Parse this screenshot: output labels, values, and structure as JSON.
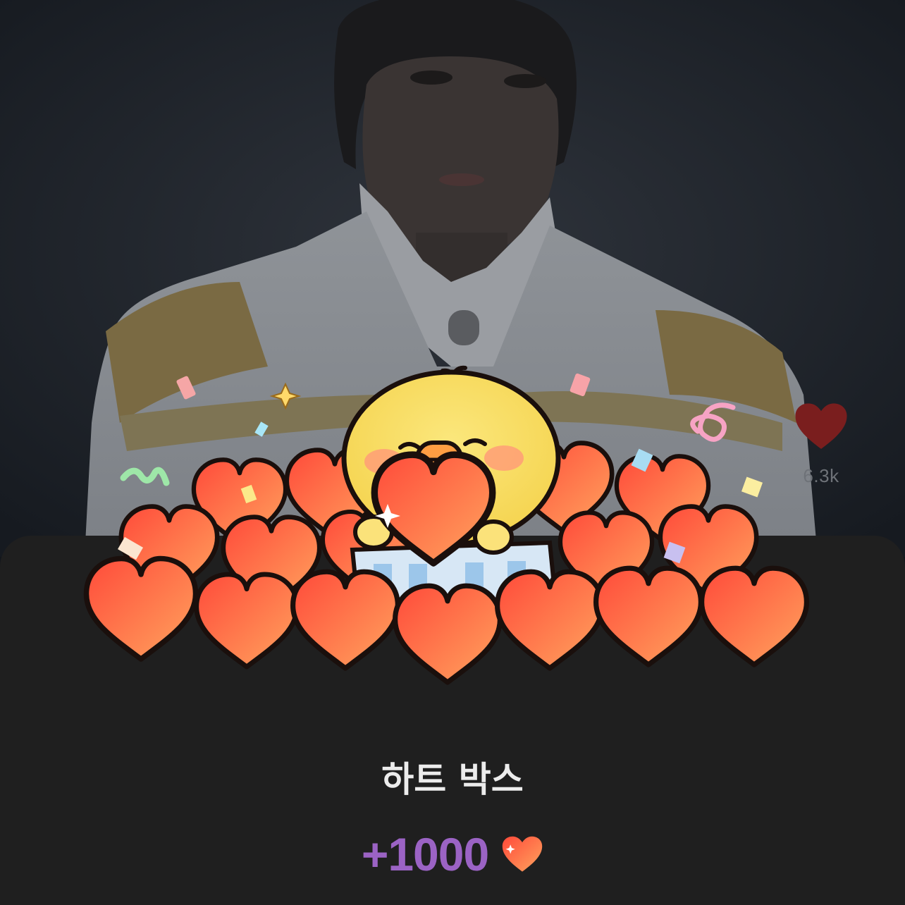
{
  "background_photo": {
    "icon": "person-photo-dimmed"
  },
  "like": {
    "icon": "heart-icon",
    "count": "6.3k",
    "color": "#7a1e1e"
  },
  "gift": {
    "illustration": "chick-holding-heart-in-heart-box",
    "title": "하트 박스",
    "value": "+1000",
    "value_color": "#9b63c4",
    "heart_icon": "heart-icon"
  },
  "colors": {
    "sheet": "#1f1f1f",
    "heart_light": "#ffa05a",
    "heart_dark": "#ff4f3a",
    "chick": "#fde06e"
  }
}
